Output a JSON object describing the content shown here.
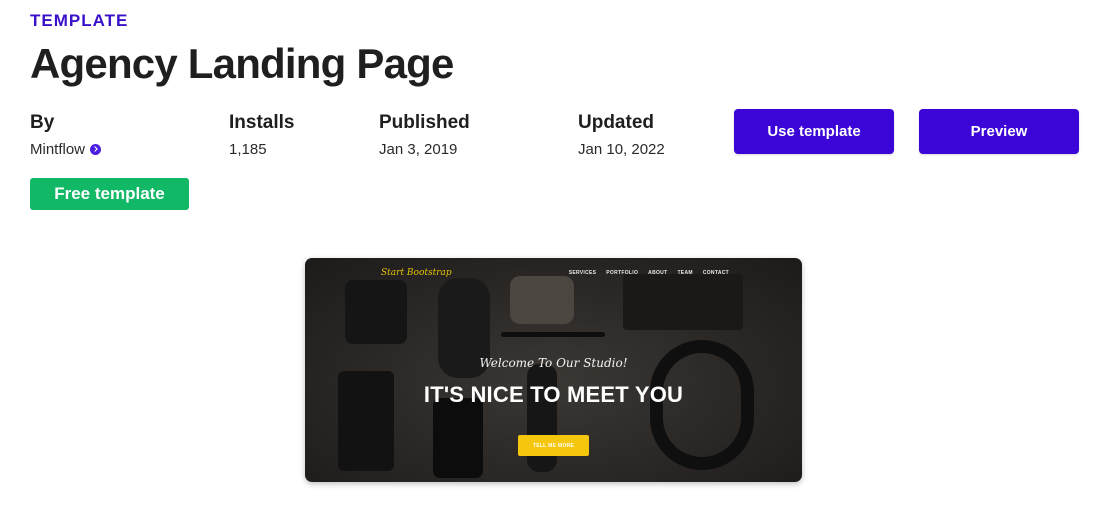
{
  "header": {
    "eyebrow": "TEMPLATE",
    "title": "Agency Landing Page"
  },
  "meta": {
    "by": {
      "label": "By",
      "value": "Mintflow"
    },
    "installs": {
      "label": "Installs",
      "value": "1,185"
    },
    "published": {
      "label": "Published",
      "value": "Jan 3, 2019"
    },
    "updated": {
      "label": "Updated",
      "value": "Jan 10, 2022"
    }
  },
  "actions": {
    "use_template": "Use template",
    "preview": "Preview"
  },
  "badge": {
    "label": "Free template"
  },
  "preview_image": {
    "brand": "Start Bootstrap",
    "nav": [
      "SERVICES",
      "PORTFOLIO",
      "ABOUT",
      "TEAM",
      "CONTACT"
    ],
    "welcome": "Welcome To Our Studio!",
    "headline": "IT'S NICE TO MEET YOU",
    "cta": "TELL ME MORE"
  },
  "colors": {
    "accent": "#3a05d6",
    "eyebrow": "#3a10c8",
    "badge": "#11b865",
    "cta": "#f4c70d"
  }
}
